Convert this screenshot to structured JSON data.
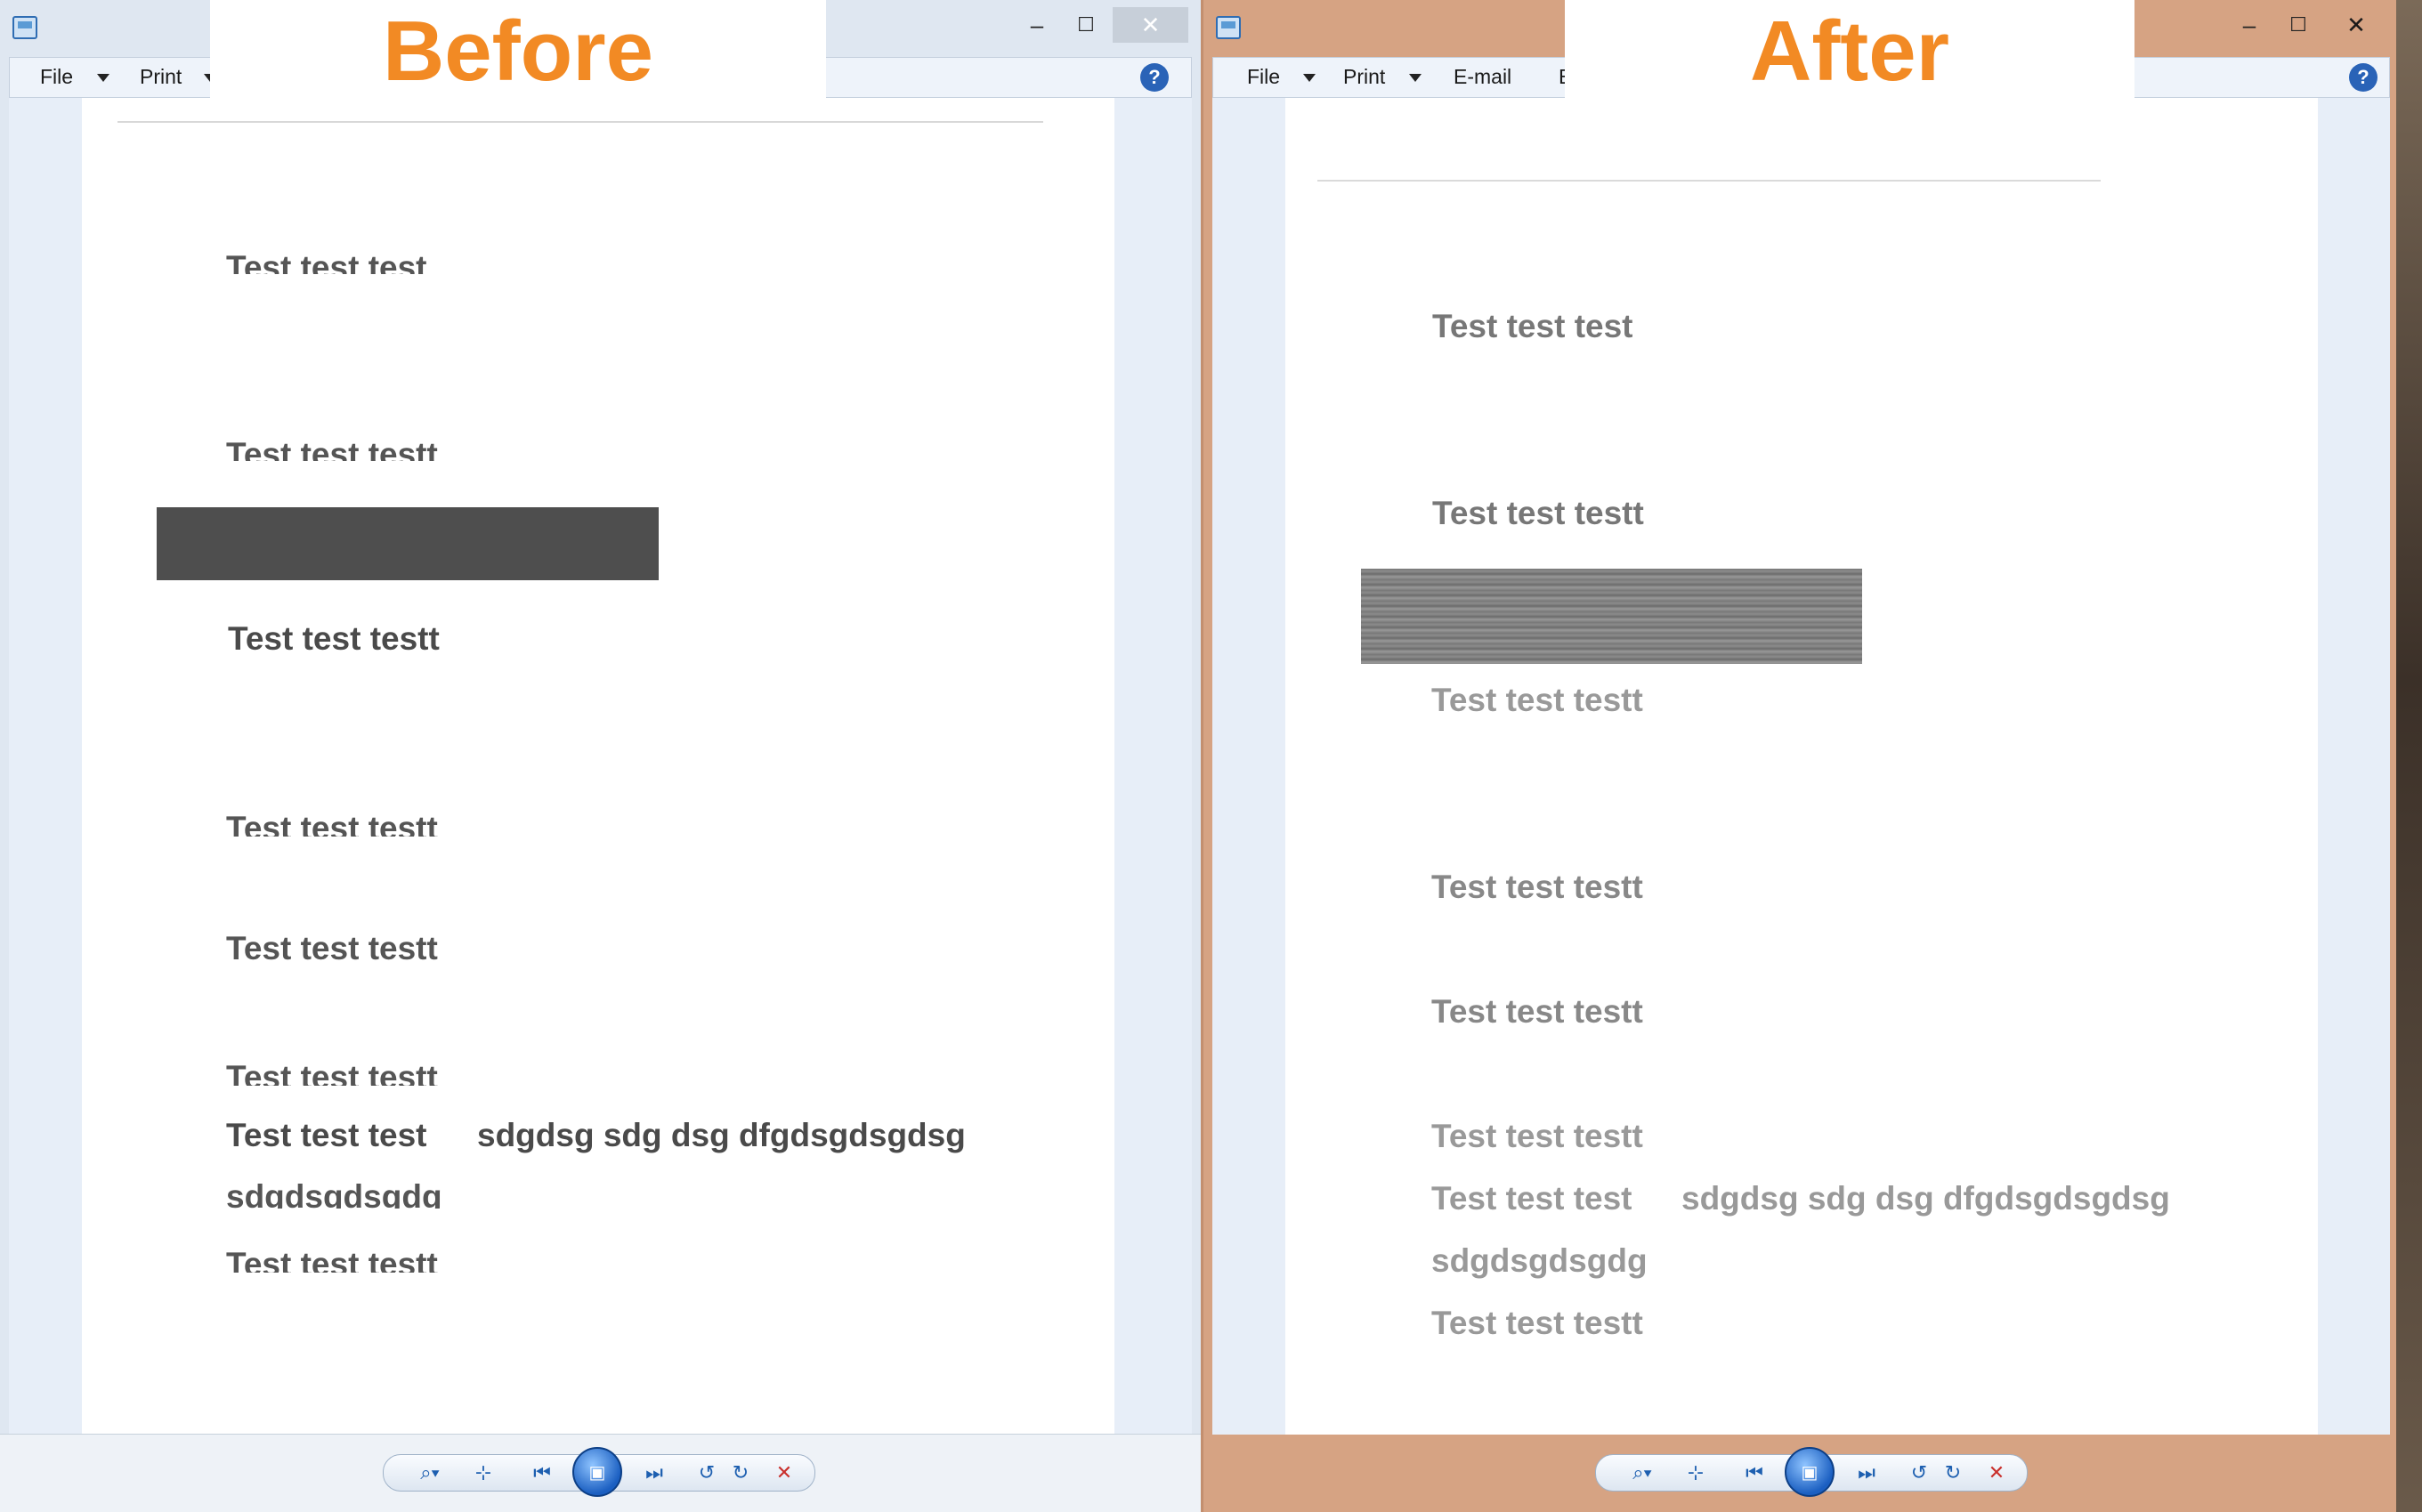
{
  "banners": {
    "before": "Before",
    "after": "After"
  },
  "window_controls": {
    "minimize": "–",
    "maximize": "☐",
    "close": "✕"
  },
  "menu": {
    "file": "File",
    "print": "Print",
    "email": "E-mail",
    "burn_partial": "E",
    "help": "?"
  },
  "before_page": {
    "lines": [
      "Test test test",
      "Test test testt",
      "Test test testt",
      "Test test testt",
      "Test test testt",
      "Test test testt",
      "Test test test",
      "sdgdsg sdg dsg dfgdsgdsgdsg",
      "sdgdsgdsgdg",
      "Test test testt"
    ]
  },
  "after_page": {
    "lines": [
      "Test test test",
      "Test test testt",
      "Test test testt",
      "Test test testt",
      "Test test testt",
      "Test test testt",
      "Test test test",
      "sdgdsg sdg dsg dfgdsgdsgdsg",
      "sdgdsgdsgdg",
      "Test test testt"
    ]
  },
  "toolbar": {
    "zoom": "⌕▾",
    "fit": "⊹",
    "previous": "⏮",
    "slideshow": "▣",
    "next": "⏭",
    "rotate_ccw": "↺",
    "rotate_cw": "↻",
    "delete": "✕"
  },
  "colors": {
    "banner_text": "#f28a24",
    "before_frame": "#dfe7f1",
    "after_frame": "#d6a383",
    "close_hover": "#c9413a"
  }
}
